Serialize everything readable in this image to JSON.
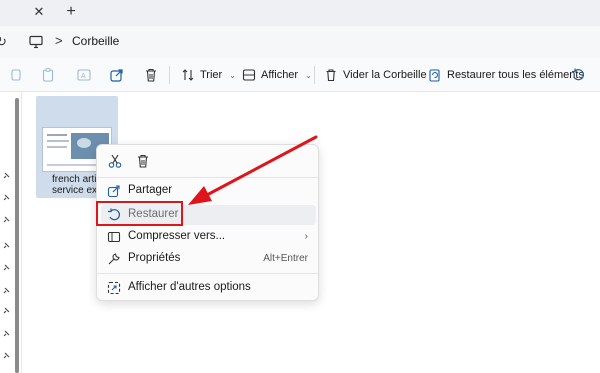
{
  "tabs": {
    "close_glyph": "✕",
    "add_glyph": "+"
  },
  "address": {
    "separator": ">",
    "location": "Corbeille"
  },
  "toolbar": {
    "sort_label": "Trier",
    "view_label": "Afficher",
    "empty_label": "Vider la Corbeille",
    "restore_all_label": "Restaurer tous les éléments",
    "restore_selection_label": "",
    "caret": "⌄"
  },
  "file": {
    "name_line1": "french artic",
    "name_line2": "service examp"
  },
  "context_menu": {
    "quick_actions": [
      "cut-icon",
      "delete-icon"
    ],
    "items": [
      {
        "label": "Partager",
        "icon": "share-icon",
        "accelerator": ""
      },
      {
        "label": "Restaurer",
        "icon": "restore-icon",
        "accelerator": ""
      },
      {
        "label": "Compresser vers...",
        "icon": "archive-icon",
        "accelerator": "›"
      },
      {
        "label": "Propriétés",
        "icon": "wrench-icon",
        "accelerator": "Alt+Entrer"
      },
      {
        "label": "Afficher d'autres options",
        "icon": "more-options-icon",
        "accelerator": ""
      }
    ]
  },
  "colors": {
    "annotation": "#e0141b",
    "accent": "#0a6cc9",
    "selection": "#cfdcec"
  }
}
